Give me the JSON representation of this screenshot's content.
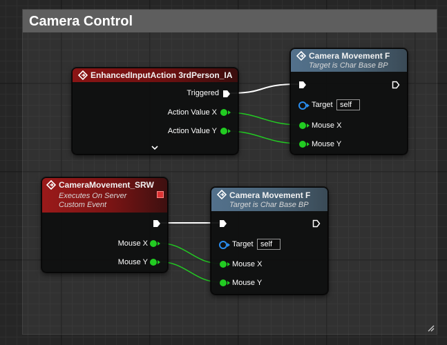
{
  "comment": {
    "title": "Camera Control"
  },
  "nodes": {
    "enhanced_input": {
      "title": "EnhancedInputAction 3rdPerson_IA",
      "pins": {
        "triggered": "Triggered",
        "action_value_x": "Action Value X",
        "action_value_y": "Action Value Y"
      }
    },
    "camera_movement_f_top": {
      "title": "Camera Movement F",
      "subtitle": "Target is Char Base BP",
      "pins": {
        "target": "Target",
        "target_value": "self",
        "mouse_x": "Mouse X",
        "mouse_y": "Mouse Y"
      }
    },
    "camera_movement_srw": {
      "title": "CameraMovement_SRW",
      "subtitle_1": "Executes On Server",
      "subtitle_2": "Custom Event",
      "pins": {
        "mouse_x": "Mouse X",
        "mouse_y": "Mouse Y"
      }
    },
    "camera_movement_f_bottom": {
      "title": "Camera Movement F",
      "subtitle": "Target is Char Base BP",
      "pins": {
        "target": "Target",
        "target_value": "self",
        "mouse_x": "Mouse X",
        "mouse_y": "Mouse Y"
      }
    }
  },
  "colors": {
    "exec_wire": "#ffffff",
    "data_wire": "#22cc22",
    "target_pin": "#2a8ef0",
    "event_header": "#8a1515",
    "function_header": "#53718c"
  },
  "icons": {
    "event_icon": "diamond-arrow-icon",
    "function_icon": "function-icon",
    "expand_icon": "chevron-down-icon",
    "delegate_icon": "delegate-pin-icon",
    "resize_icon": "resize-grip-icon"
  }
}
